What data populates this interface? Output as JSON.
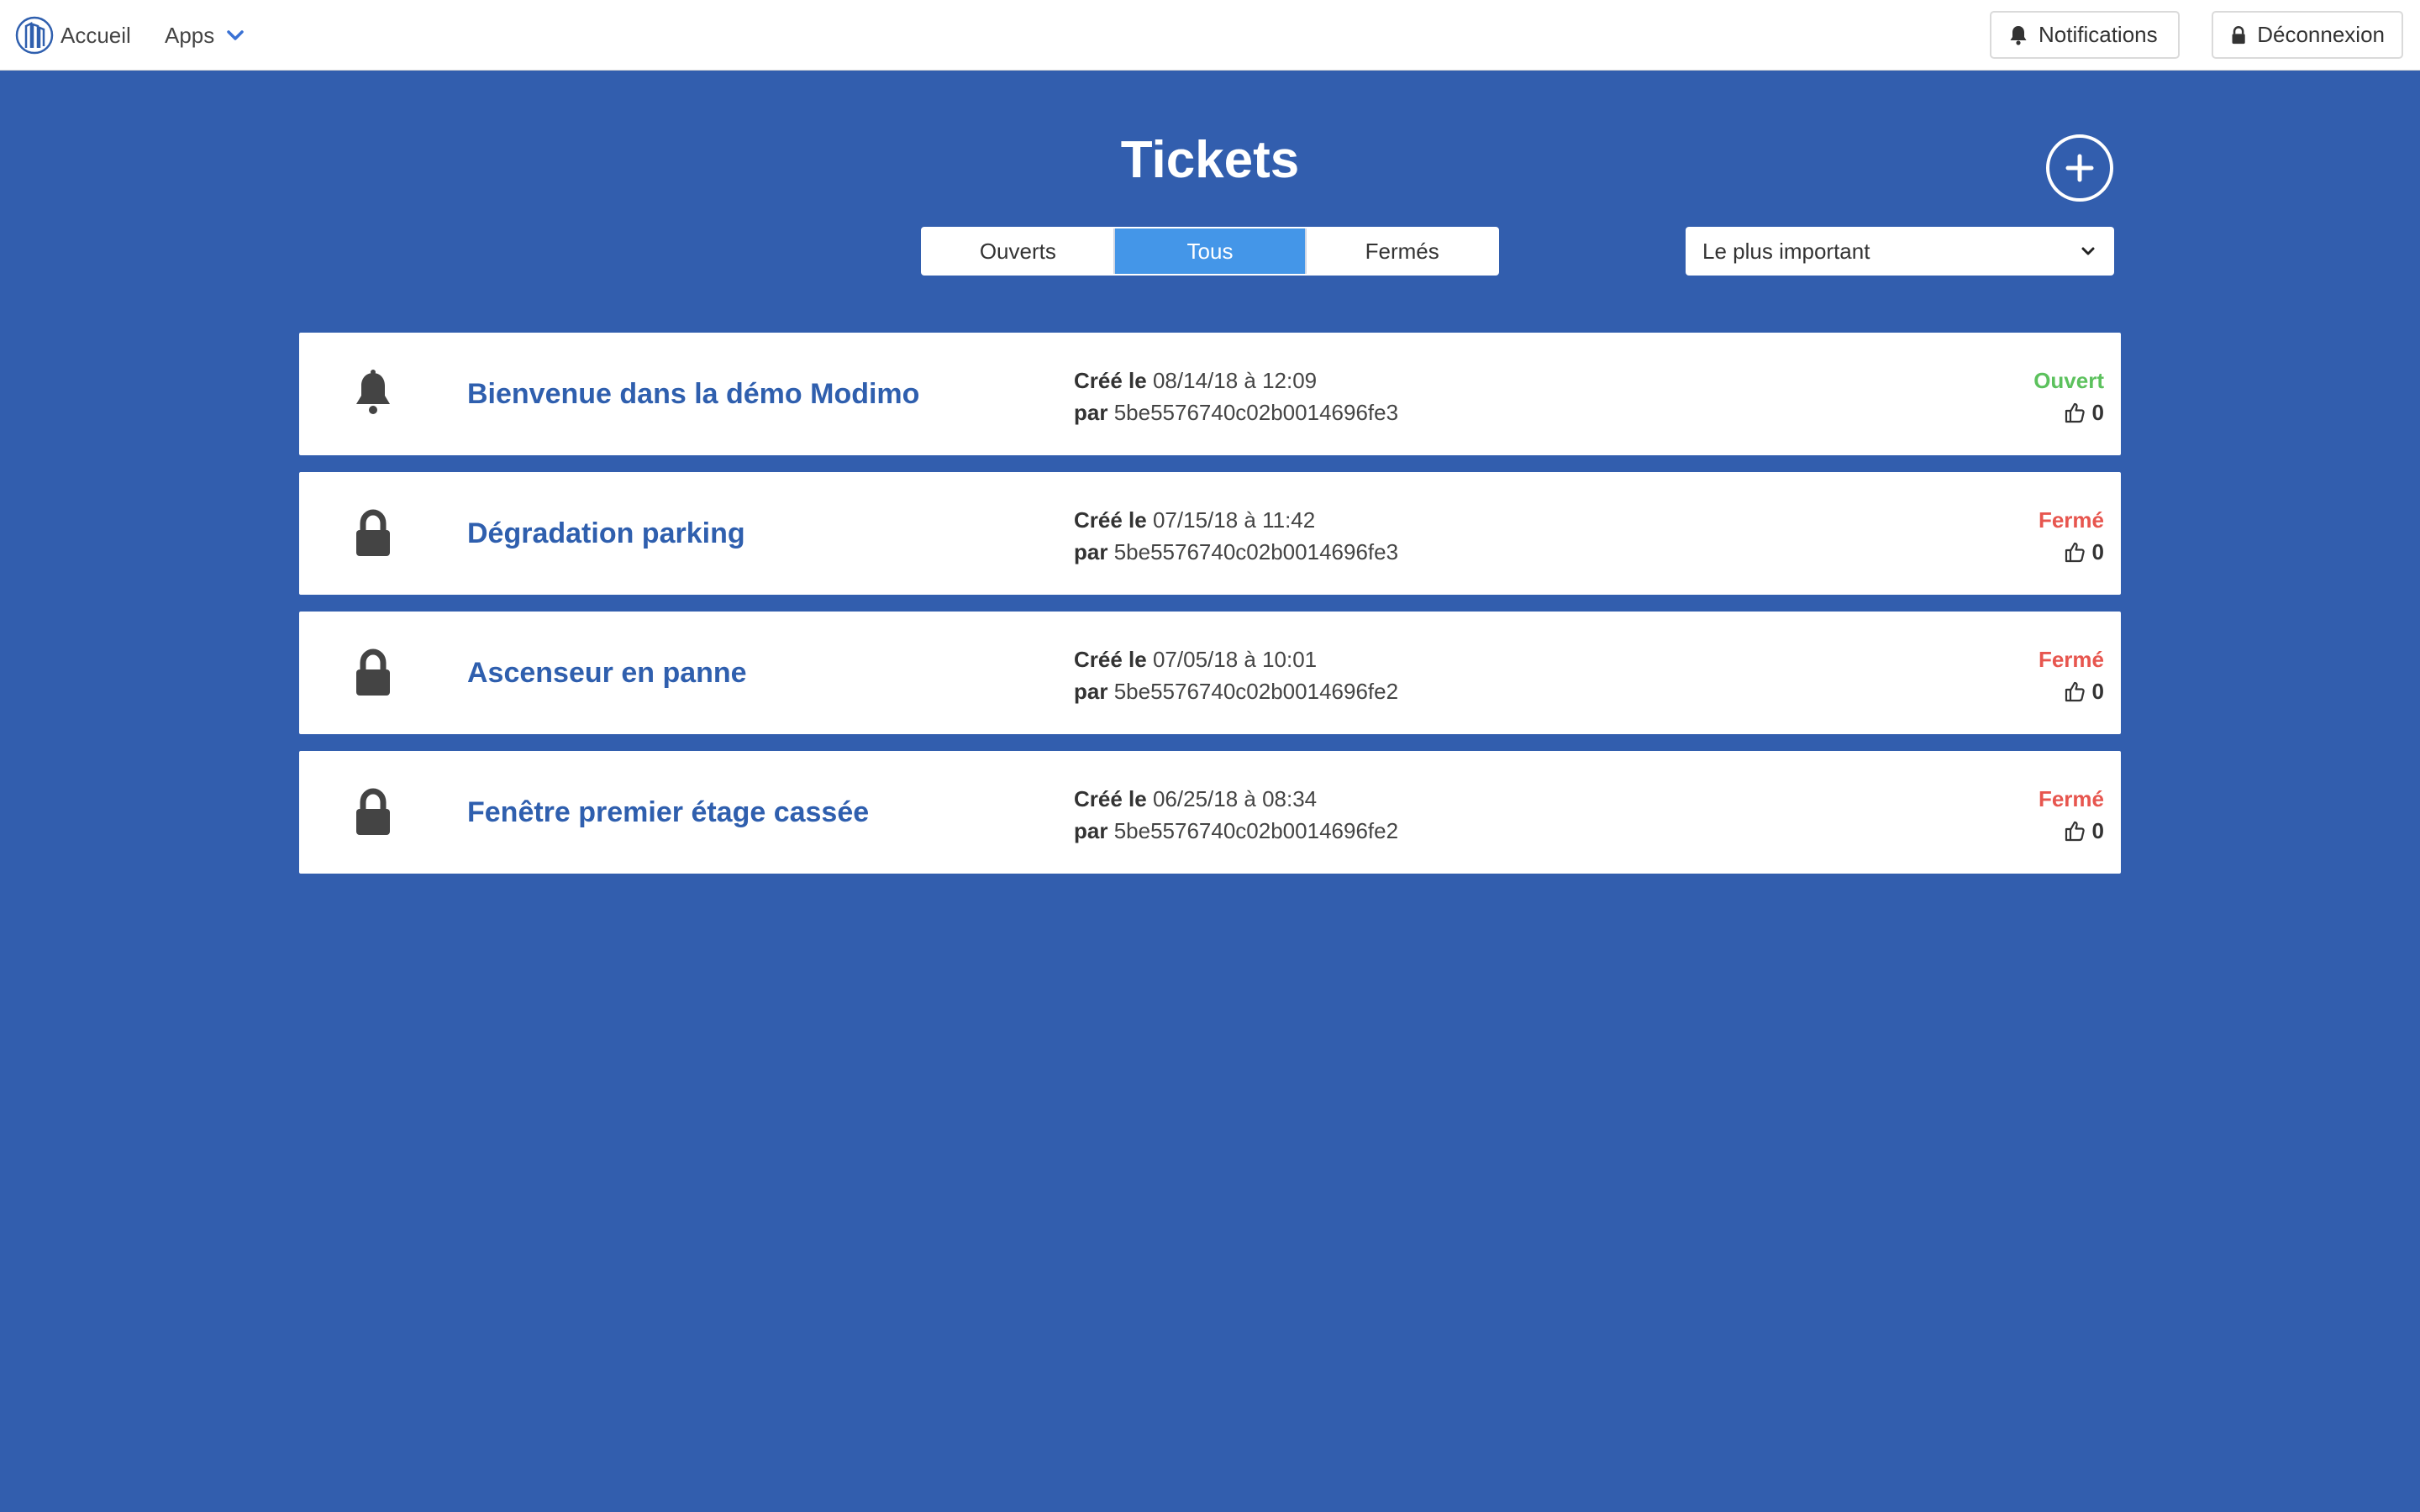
{
  "navbar": {
    "home_label": "Accueil",
    "apps_label": "Apps",
    "notifications_label": "Notifications",
    "logout_label": "Déconnexion"
  },
  "page": {
    "title": "Tickets",
    "filters": [
      "Ouverts",
      "Tous",
      "Fermés"
    ],
    "active_filter": "Tous",
    "sort_selected": "Le plus important"
  },
  "labels": {
    "created": "Créé le",
    "by": "par"
  },
  "colors": {
    "background": "#325eae",
    "accent": "#4496e8",
    "title_blue": "#2f5fae",
    "open_green": "#5cc15d",
    "closed_red": "#e7564f"
  },
  "tickets": [
    {
      "icon": "bell-icon",
      "title": "Bienvenue dans la démo Modimo",
      "date": "08/14/18 à 12:09",
      "author": "5be5576740c02b0014696fe3",
      "status": "Ouvert",
      "likes": "0"
    },
    {
      "icon": "lock-icon",
      "title": "Dégradation parking",
      "date": "07/15/18 à 11:42",
      "author": "5be5576740c02b0014696fe3",
      "status": "Fermé",
      "likes": "0"
    },
    {
      "icon": "lock-icon",
      "title": "Ascenseur en panne",
      "date": "07/05/18 à 10:01",
      "author": "5be5576740c02b0014696fe2",
      "status": "Fermé",
      "likes": "0"
    },
    {
      "icon": "lock-icon",
      "title": "Fenêtre premier étage cassée",
      "date": "06/25/18 à 08:34",
      "author": "5be5576740c02b0014696fe2",
      "status": "Fermé",
      "likes": "0"
    }
  ]
}
